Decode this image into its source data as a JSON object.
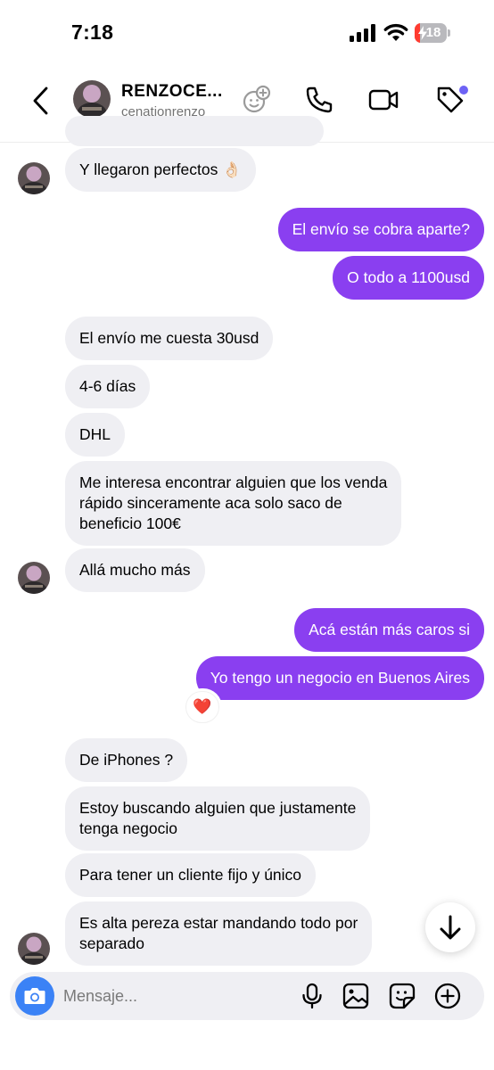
{
  "status_bar": {
    "time": "7:18",
    "battery": "18",
    "battery_level": 0.18
  },
  "header": {
    "name": "RENZOCE...",
    "username": "cenationrenzo",
    "icons": [
      "back-arrow-icon",
      "add-to-group-icon",
      "phone-icon",
      "video-icon",
      "tag-icon"
    ]
  },
  "messages": [
    {
      "from": "them",
      "text": "Y llegaron perfectos 👌🏻"
    },
    {
      "from": "me",
      "text": "El envío se cobra aparte?"
    },
    {
      "from": "me",
      "text": "O todo a 1100usd"
    },
    {
      "from": "them",
      "text": "El envío me cuesta 30usd"
    },
    {
      "from": "them",
      "text": "4-6 días"
    },
    {
      "from": "them",
      "text": "DHL"
    },
    {
      "from": "them",
      "text": "Me interesa encontrar alguien que los venda\nrápido sinceramente aca solo saco de\nbeneficio 100€"
    },
    {
      "from": "them",
      "text": "Allá mucho más"
    },
    {
      "from": "me",
      "text": "Acá están más caros si"
    },
    {
      "from": "me",
      "text": "Yo tengo un negocio en Buenos Aires",
      "reaction": "❤️"
    },
    {
      "from": "them",
      "text": "De iPhones ?"
    },
    {
      "from": "them",
      "text": "Estoy buscando alguien que justamente\ntenga negocio"
    },
    {
      "from": "them",
      "text": "Para tener un cliente fijo y único"
    },
    {
      "from": "them",
      "text": "Es alta pereza estar mandando todo por\nseparado"
    }
  ],
  "composer": {
    "placeholder": "Mensaje...",
    "icons": [
      "camera-icon",
      "microphone-icon",
      "gallery-icon",
      "sticker-icon",
      "add-icon"
    ]
  },
  "colors": {
    "outgoing_bubble": "#8a3ff0",
    "incoming_bubble": "#efeff3",
    "camera_button": "#3b82f6",
    "notification_dot": "#6e63f5"
  }
}
